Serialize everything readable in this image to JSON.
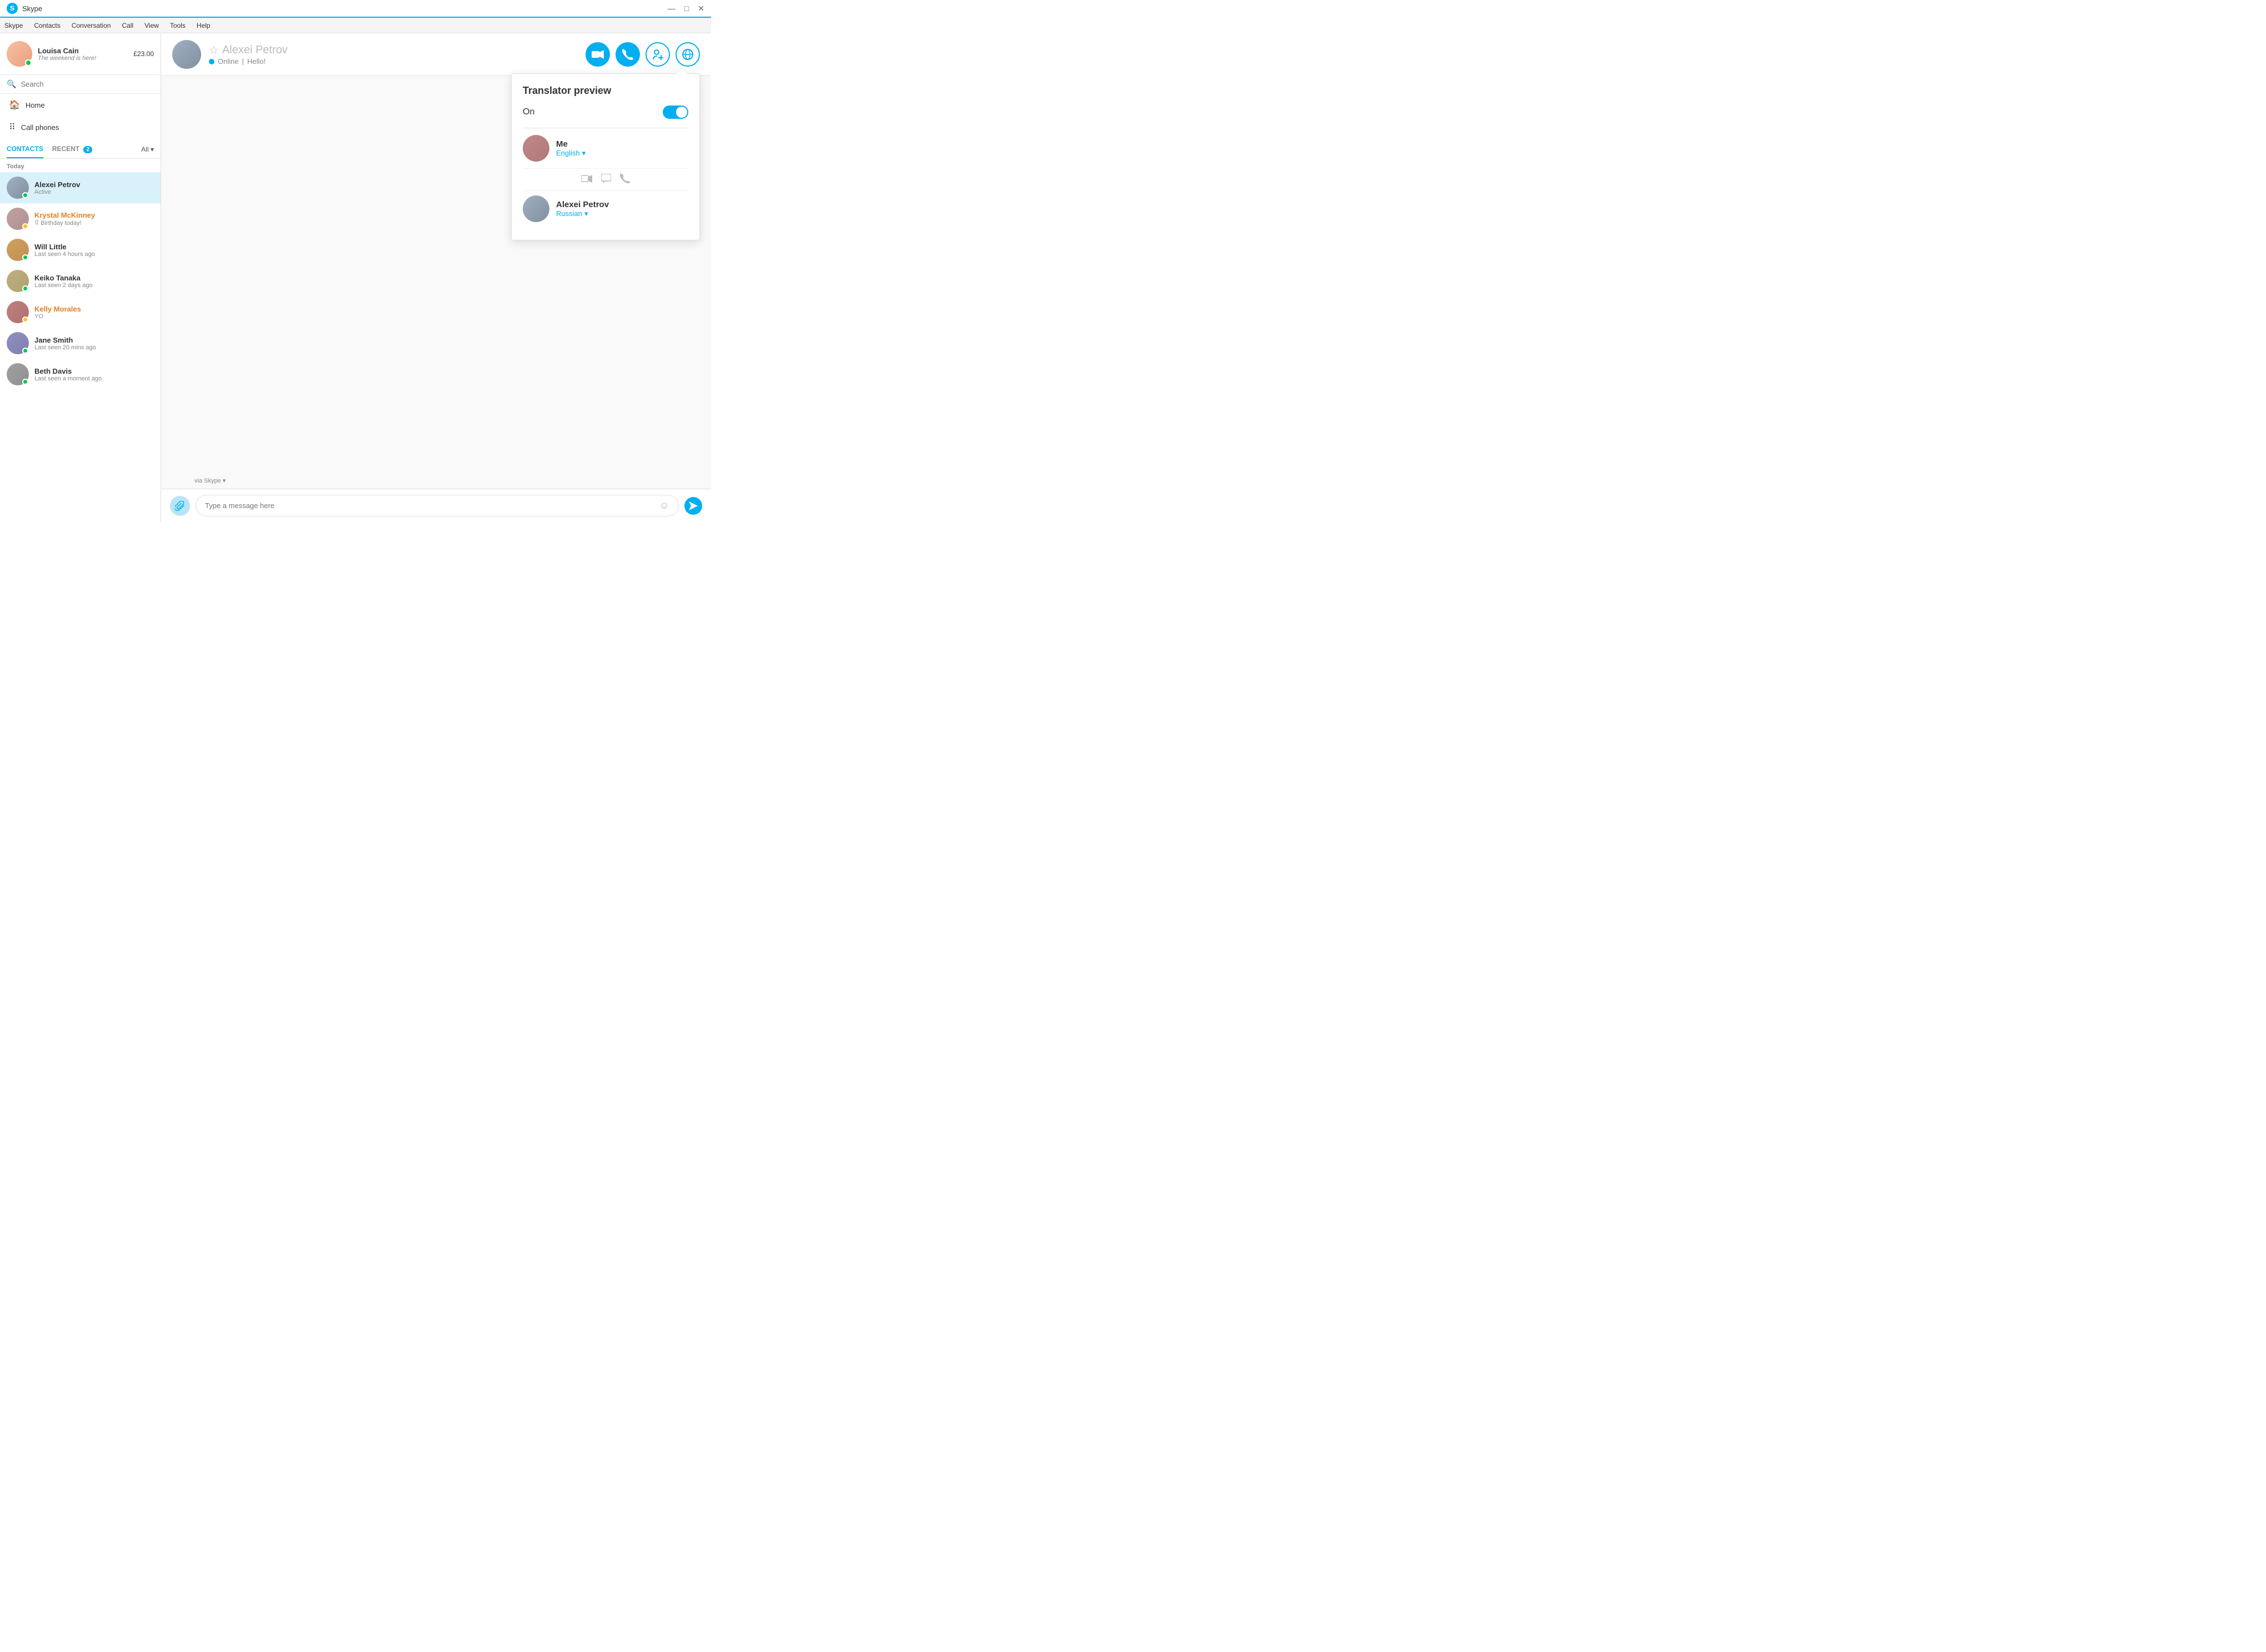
{
  "titleBar": {
    "appName": "Skype",
    "logo": "S",
    "controls": {
      "minimize": "—",
      "maximize": "□",
      "close": "✕"
    }
  },
  "menuBar": {
    "items": [
      "Skype",
      "Contacts",
      "Conversation",
      "Call",
      "View",
      "Tools",
      "Help"
    ]
  },
  "sidebar": {
    "profile": {
      "name": "Louisa Cain",
      "status": "The weekend is here!",
      "balance": "£23.00"
    },
    "search": {
      "placeholder": "Search",
      "label": "Search"
    },
    "nav": {
      "home": "Home",
      "callPhones": "Call phones"
    },
    "tabs": {
      "contacts": "CONTACTS",
      "recent": "RECENT",
      "recentBadge": "2",
      "all": "All"
    },
    "sectionHeader": "Today",
    "contacts": [
      {
        "id": "alexei-petrov",
        "name": "Alexei Petrov",
        "sub": "Active",
        "status": "online",
        "active": true
      },
      {
        "id": "krystal-mckinney",
        "name": "Krystal McKinney",
        "sub": "Birthday today!",
        "status": "away",
        "active": false,
        "orange": true,
        "birthday": true
      },
      {
        "id": "will-little",
        "name": "Will Little",
        "sub": "Last seen 4 hours ago",
        "status": "online",
        "active": false
      },
      {
        "id": "keiko-tanaka",
        "name": "Keiko Tanaka",
        "sub": "Last seen 2 days ago",
        "status": "online",
        "active": false
      },
      {
        "id": "kelly-morales",
        "name": "Kelly Morales",
        "sub": "YO",
        "status": "away",
        "active": false,
        "orange": true
      },
      {
        "id": "jane-smith",
        "name": "Jane Smith",
        "sub": "Last seen 20 mins ago",
        "status": "online",
        "active": false
      },
      {
        "id": "beth-davis",
        "name": "Beth Davis",
        "sub": "Last seen a moment ago",
        "status": "online",
        "active": false
      }
    ]
  },
  "header": {
    "contactName": "Alexei Petrov",
    "star": "☆",
    "statusLabel": "Online",
    "statusSep": "|",
    "statusMsg": "Hello!",
    "buttons": {
      "video": "video-call",
      "audio": "audio-call",
      "addPerson": "add-person",
      "translator": "translator"
    }
  },
  "messageBar": {
    "viaLabel": "via Skype",
    "viaDropdown": "▾",
    "inputPlaceholder": "Type a message here",
    "emojiIcon": "☺"
  },
  "translatorPopup": {
    "title": "Translator preview",
    "onLabel": "On",
    "toggleOn": true,
    "me": {
      "name": "Me",
      "language": "English",
      "dropdownIcon": "▾"
    },
    "contact": {
      "name": "Alexei Petrov",
      "language": "Russian",
      "dropdownIcon": "▾"
    },
    "icons": {
      "video": "📹",
      "chat": "💬",
      "phone": "📞"
    }
  }
}
